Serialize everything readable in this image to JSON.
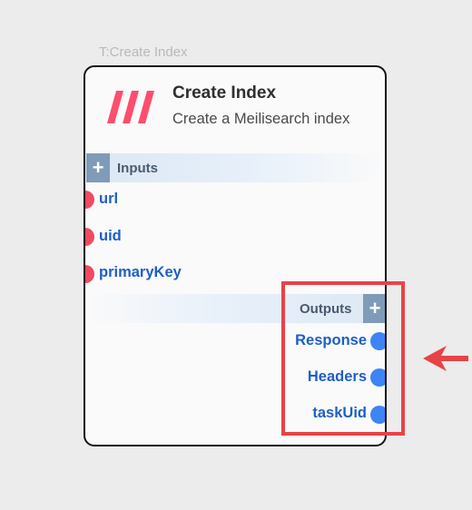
{
  "node": {
    "caption": "T:Create Index",
    "title": "Create Index",
    "description": "Create a Meilisearch index",
    "logo_icon": "meilisearch-logo",
    "inputs_label": "Inputs",
    "outputs_label": "Outputs",
    "add_symbol": "+",
    "inputs": [
      {
        "label": "url"
      },
      {
        "label": "uid"
      },
      {
        "label": "primaryKey"
      }
    ],
    "outputs": [
      {
        "label": "Response"
      },
      {
        "label": "Headers"
      },
      {
        "label": "taskUid"
      }
    ]
  },
  "colors": {
    "input_port": "#ee4b62",
    "output_port": "#3d84f5",
    "port_label": "#1f5ec6",
    "highlight": "#e84347",
    "logo": "#ff4d6d"
  }
}
